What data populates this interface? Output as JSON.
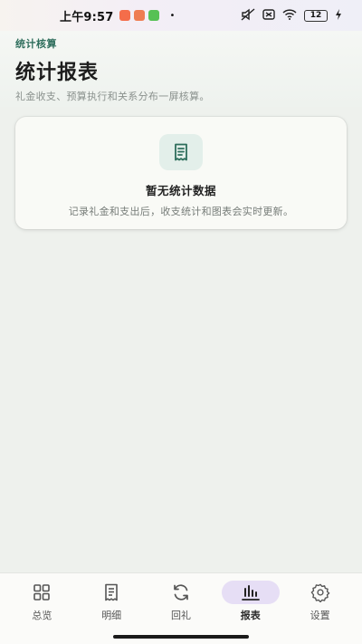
{
  "status_bar": {
    "time": "上午9:57",
    "separator": "•",
    "battery": "12"
  },
  "header": {
    "eyebrow": "统计核算",
    "title": "统计报表",
    "subtitle": "礼金收支、预算执行和关系分布一屏核算。"
  },
  "empty_state": {
    "icon": "receipt-icon",
    "title": "暂无统计数据",
    "description": "记录礼金和支出后，收支统计和图表会实时更新。"
  },
  "nav": {
    "items": [
      {
        "label": "总览",
        "icon": "grid-icon"
      },
      {
        "label": "明细",
        "icon": "receipt-icon"
      },
      {
        "label": "回礼",
        "icon": "refresh-icon"
      },
      {
        "label": "报表",
        "icon": "bar-chart-icon"
      },
      {
        "label": "设置",
        "icon": "gear-icon"
      }
    ],
    "active": "报表"
  },
  "colors": {
    "accent": "#2e6e5c",
    "active_pill": "#e6def5",
    "background": "#eef1ed"
  }
}
